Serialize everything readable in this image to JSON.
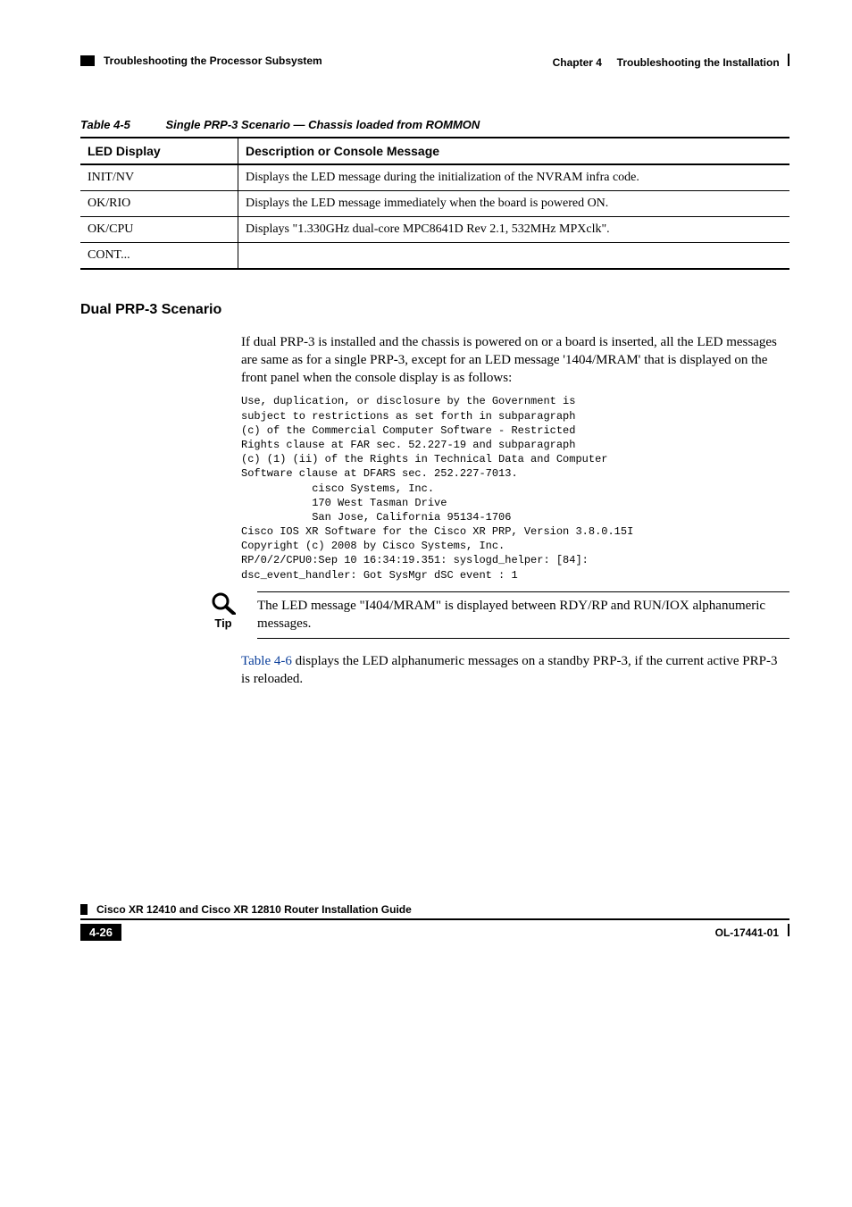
{
  "header": {
    "left": "Troubleshooting the Processor Subsystem",
    "right_chapter": "Chapter 4",
    "right_title": "Troubleshooting the Installation"
  },
  "table": {
    "caption_num": "Table 4-5",
    "caption_title": "Single PRP-3 Scenario — Chassis loaded from ROMMON",
    "col1": "LED Display",
    "col2": "Description or Console Message",
    "rows": [
      {
        "c1": "INIT/NV",
        "c2": "Displays the LED message during the initialization of the NVRAM infra code."
      },
      {
        "c1": "OK/RIO",
        "c2": "Displays the LED message immediately when the board is powered ON."
      },
      {
        "c1": "OK/CPU",
        "c2": "Displays \"1.330GHz dual-core MPC8641D Rev 2.1, 532MHz MPXclk\"."
      },
      {
        "c1": "CONT...",
        "c2": ""
      }
    ]
  },
  "section": {
    "heading": "Dual PRP-3 Scenario",
    "para": "If dual PRP-3 is installed and the chassis is powered on or a board is inserted, all the LED messages are same as for a single PRP-3, except for an LED message '1404/MRAM' that is displayed on the front panel when the console display is as follows:",
    "code": "Use, duplication, or disclosure by the Government is\nsubject to restrictions as set forth in subparagraph\n(c) of the Commercial Computer Software - Restricted\nRights clause at FAR sec. 52.227-19 and subparagraph\n(c) (1) (ii) of the Rights in Technical Data and Computer\nSoftware clause at DFARS sec. 252.227-7013.\n           cisco Systems, Inc.\n           170 West Tasman Drive\n           San Jose, California 95134-1706\nCisco IOS XR Software for the Cisco XR PRP, Version 3.8.0.15I\nCopyright (c) 2008 by Cisco Systems, Inc.\nRP/0/2/CPU0:Sep 10 16:34:19.351: syslogd_helper: [84]:\ndsc_event_handler: Got SysMgr dSC event : 1"
  },
  "tip": {
    "label": "Tip",
    "text": "The LED message \"I404/MRAM\" is displayed between RDY/RP and RUN/IOX alphanumeric messages."
  },
  "after_tip": {
    "link": "Table 4-6",
    "text_rest": " displays the LED alphanumeric messages on a standby PRP-3, if the current active PRP-3 is reloaded."
  },
  "footer": {
    "doc_title": "Cisco XR 12410 and Cisco XR 12810 Router Installation Guide",
    "page_num": "4-26",
    "doc_num": "OL-17441-01"
  }
}
